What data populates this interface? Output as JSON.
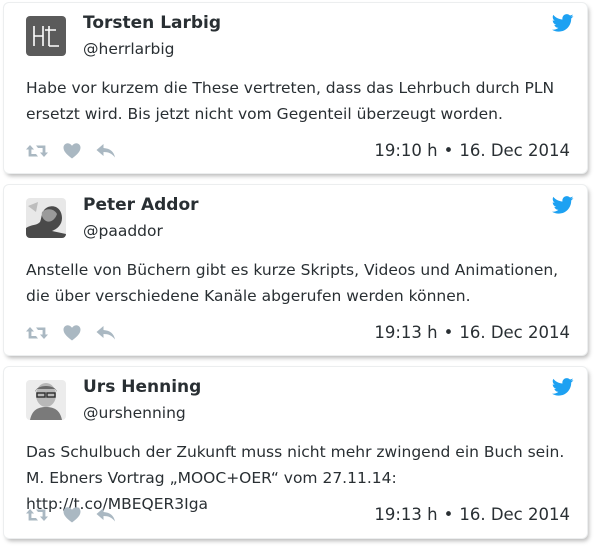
{
  "colors": {
    "twitter_blue": "#1da1f2",
    "action_gray": "#aab8c2",
    "text": "#292f33"
  },
  "tweets": [
    {
      "name": "Torsten Larbig",
      "handle": "@herrlarbig",
      "avatar_icon": "hl-logo-avatar",
      "text": "Habe vor kurzem die These vertreten, dass das Lehrbuch durch PLN ersetzt wird. Bis jetzt nicht vom Gegenteil überzeugt worden.",
      "time": "19:10 h",
      "separator": "•",
      "date": "16. Dec 2014"
    },
    {
      "name": "Peter Addor",
      "handle": "@paaddor",
      "avatar_icon": "person-photo-avatar",
      "text": "Anstelle von Büchern gibt es kurze Skripts, Videos und Animationen, die über verschiedene Kanäle abgerufen werden können.",
      "time": "19:13 h",
      "separator": "•",
      "date": "16. Dec 2014"
    },
    {
      "name": "Urs Henning",
      "handle": "@urshenning",
      "avatar_icon": "person-photo-avatar",
      "text": "Das Schulbuch der Zukunft muss nicht mehr zwingend ein Buch sein. M. Ebners Vortrag „MOOC+OER“ vom 27.11.14: http://t.co/MBEQER3Iga",
      "time": "19:13 h",
      "separator": "•",
      "date": "16. Dec 2014"
    }
  ]
}
